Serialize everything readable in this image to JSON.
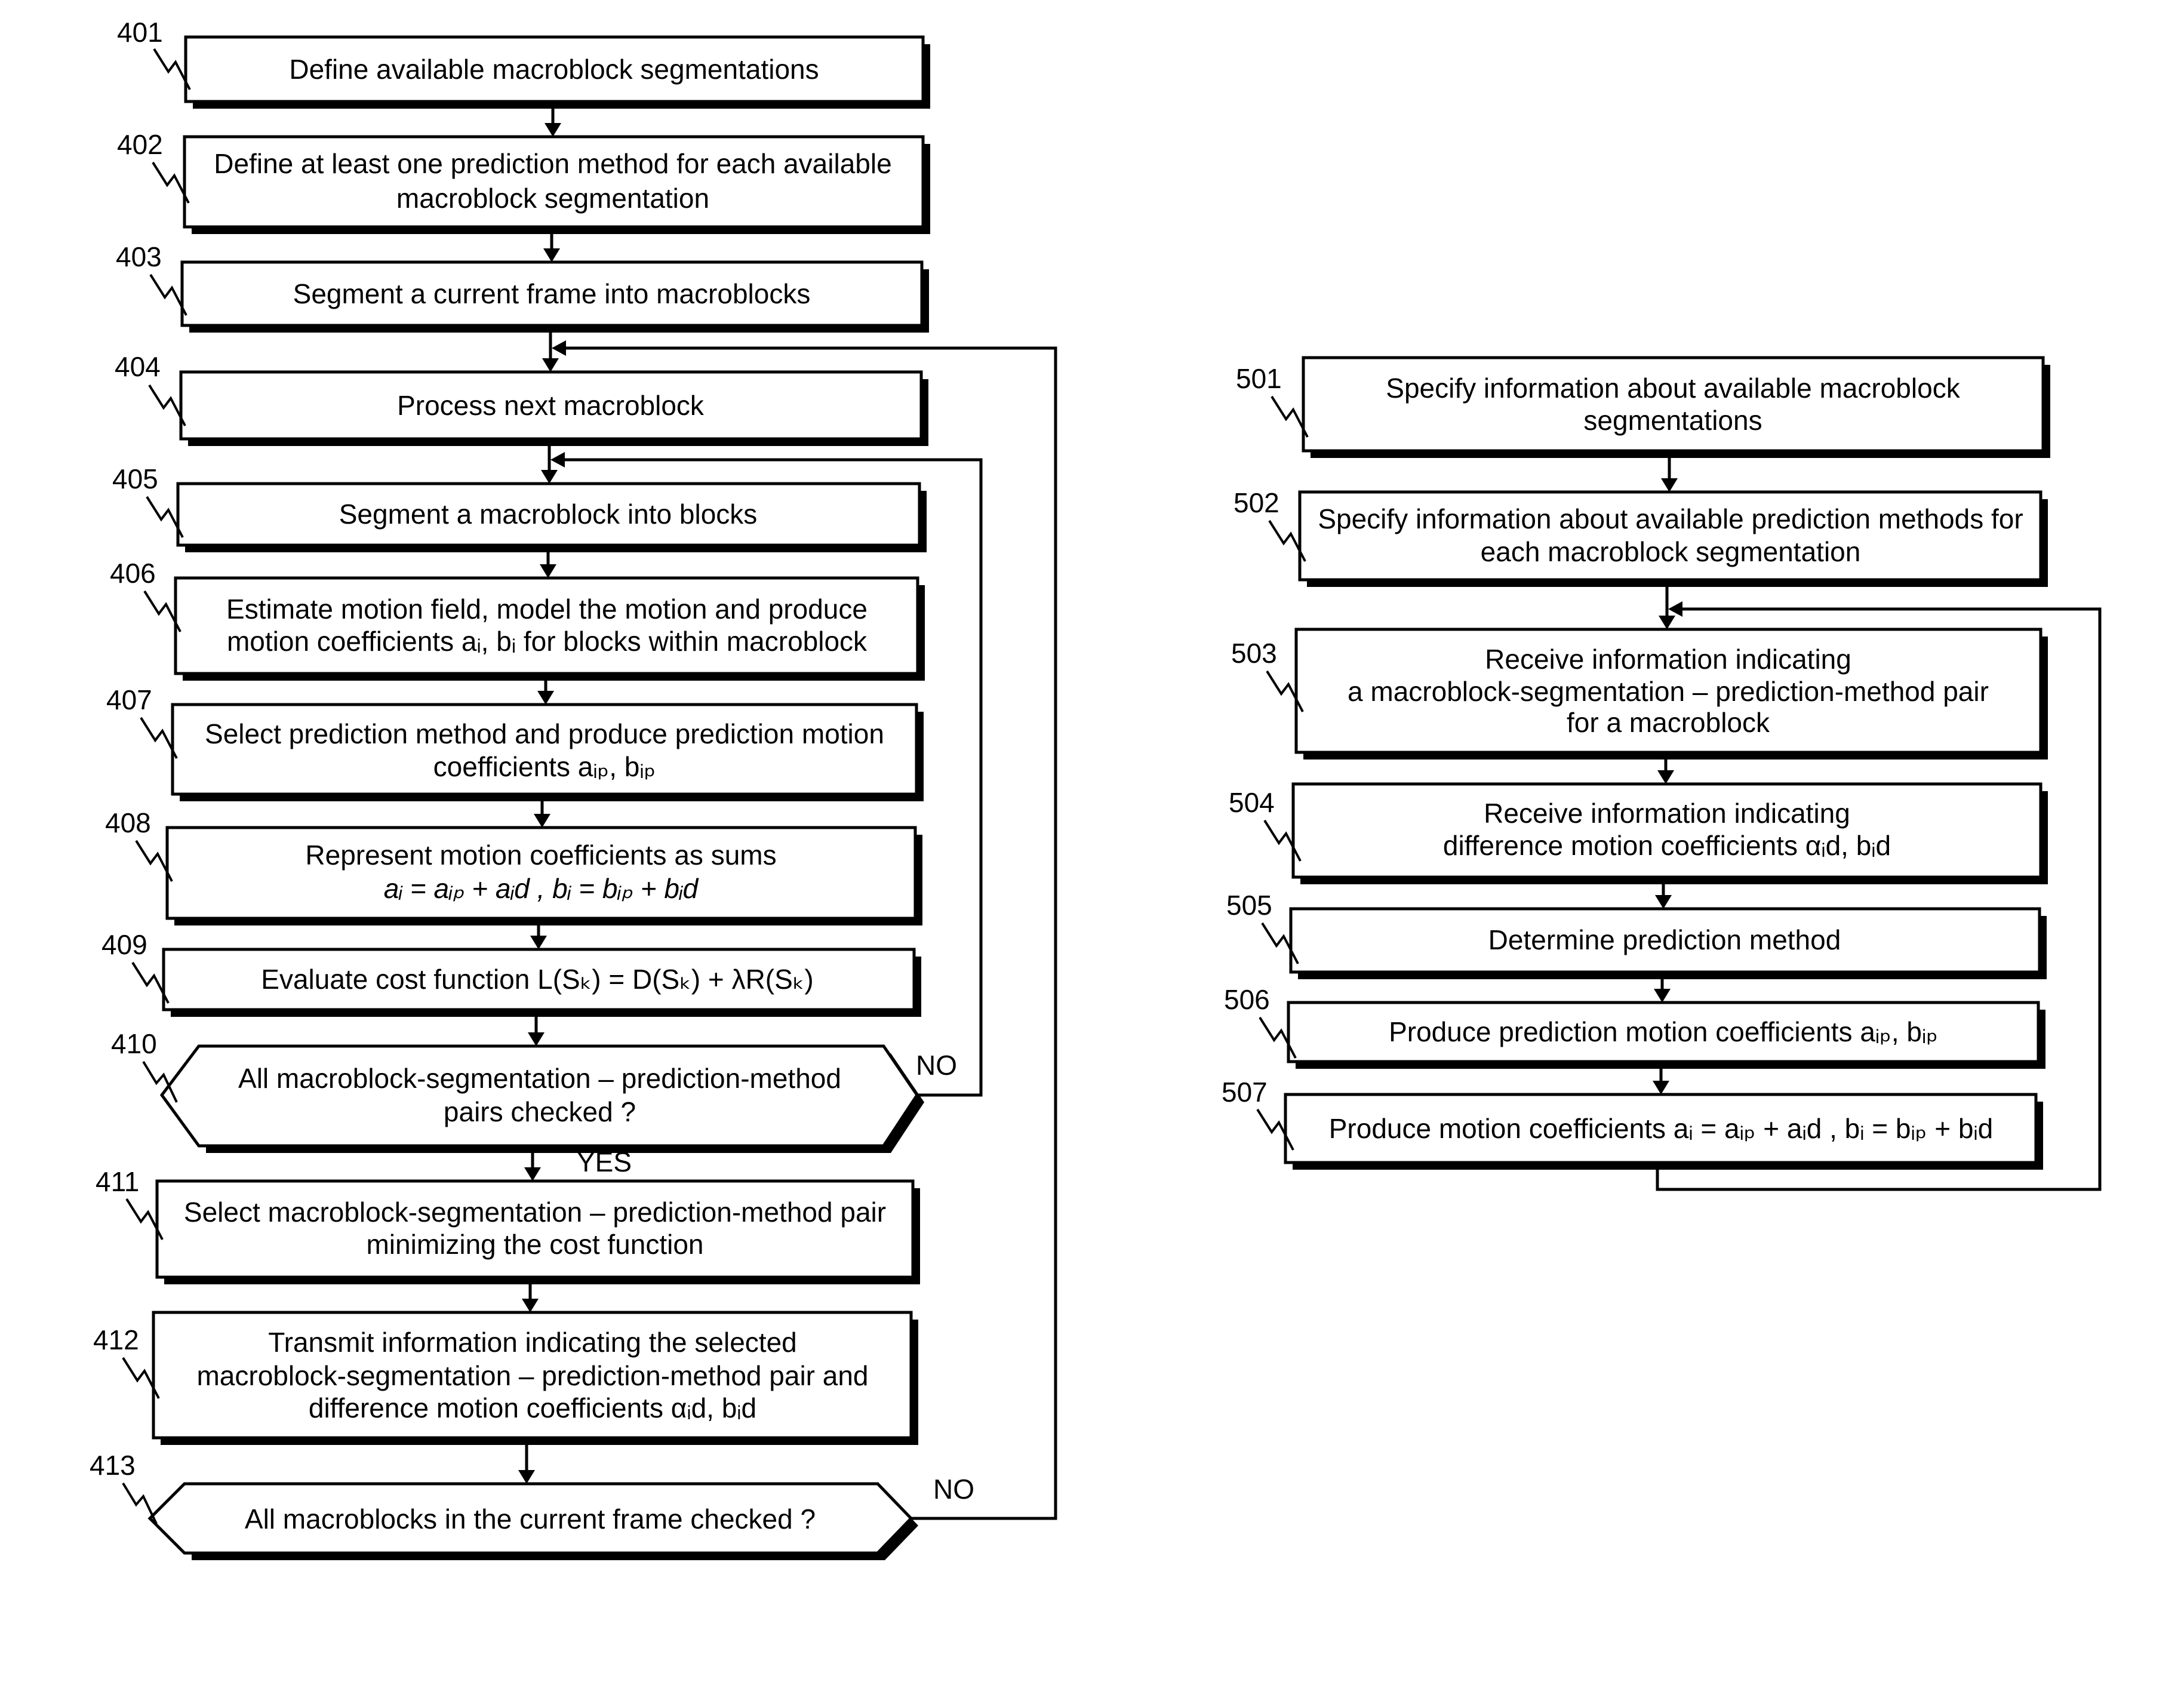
{
  "figure": {
    "left_flowchart": {
      "steps": [
        {
          "ref": "401",
          "lines": [
            "Define available macroblock segmentations"
          ]
        },
        {
          "ref": "402",
          "lines": [
            "Define at least one prediction method for each available",
            "macroblock segmentation"
          ]
        },
        {
          "ref": "403",
          "lines": [
            "Segment a current frame into macroblocks"
          ]
        },
        {
          "ref": "404",
          "lines": [
            "Process next macroblock"
          ]
        },
        {
          "ref": "405",
          "lines": [
            "Segment a macroblock into blocks"
          ]
        },
        {
          "ref": "406",
          "lines": [
            "Estimate motion field, model the motion and produce",
            "motion coefficients aᵢ, bᵢ for blocks within macroblock"
          ]
        },
        {
          "ref": "407",
          "lines": [
            "Select prediction method and produce prediction motion",
            "coefficients aᵢₚ, bᵢₚ"
          ]
        },
        {
          "ref": "408",
          "lines": [
            "Represent motion coefficients as sums",
            "aᵢ = aᵢₚ + aᵢd , bᵢ = bᵢₚ + bᵢd"
          ]
        },
        {
          "ref": "409",
          "lines": [
            "Evaluate cost function L(Sₖ) = D(Sₖ) + λR(Sₖ)"
          ]
        },
        {
          "ref": "410",
          "type": "decision",
          "lines": [
            "All macroblock-segmentation – prediction-method",
            "pairs checked ?"
          ],
          "no_label": "NO",
          "yes_label": "YES"
        },
        {
          "ref": "411",
          "lines": [
            "Select macroblock-segmentation – prediction-method pair",
            "minimizing the cost function"
          ]
        },
        {
          "ref": "412",
          "lines": [
            "Transmit information indicating the selected",
            "macroblock-segmentation – prediction-method pair and",
            "difference motion coefficients αᵢd, bᵢd"
          ]
        },
        {
          "ref": "413",
          "type": "decision",
          "lines": [
            "All macroblocks in the current frame checked ?"
          ],
          "no_label": "NO"
        }
      ]
    },
    "right_flowchart": {
      "steps": [
        {
          "ref": "501",
          "lines": [
            "Specify information about available macroblock",
            "segmentations"
          ]
        },
        {
          "ref": "502",
          "lines": [
            "Specify information about available prediction methods for",
            "each macroblock segmentation"
          ]
        },
        {
          "ref": "503",
          "lines": [
            "Receive information indicating",
            "a macroblock-segmentation – prediction-method pair",
            "for a macroblock"
          ]
        },
        {
          "ref": "504",
          "lines": [
            "Receive information indicating",
            "difference motion coefficients αᵢd, bᵢd"
          ]
        },
        {
          "ref": "505",
          "lines": [
            "Determine prediction method"
          ]
        },
        {
          "ref": "506",
          "lines": [
            "Produce prediction motion coefficients aᵢₚ, bᵢₚ"
          ]
        },
        {
          "ref": "507",
          "lines": [
            "Produce motion coefficients aᵢ = aᵢₚ + aᵢd , bᵢ = bᵢₚ + bᵢd"
          ]
        }
      ]
    }
  }
}
